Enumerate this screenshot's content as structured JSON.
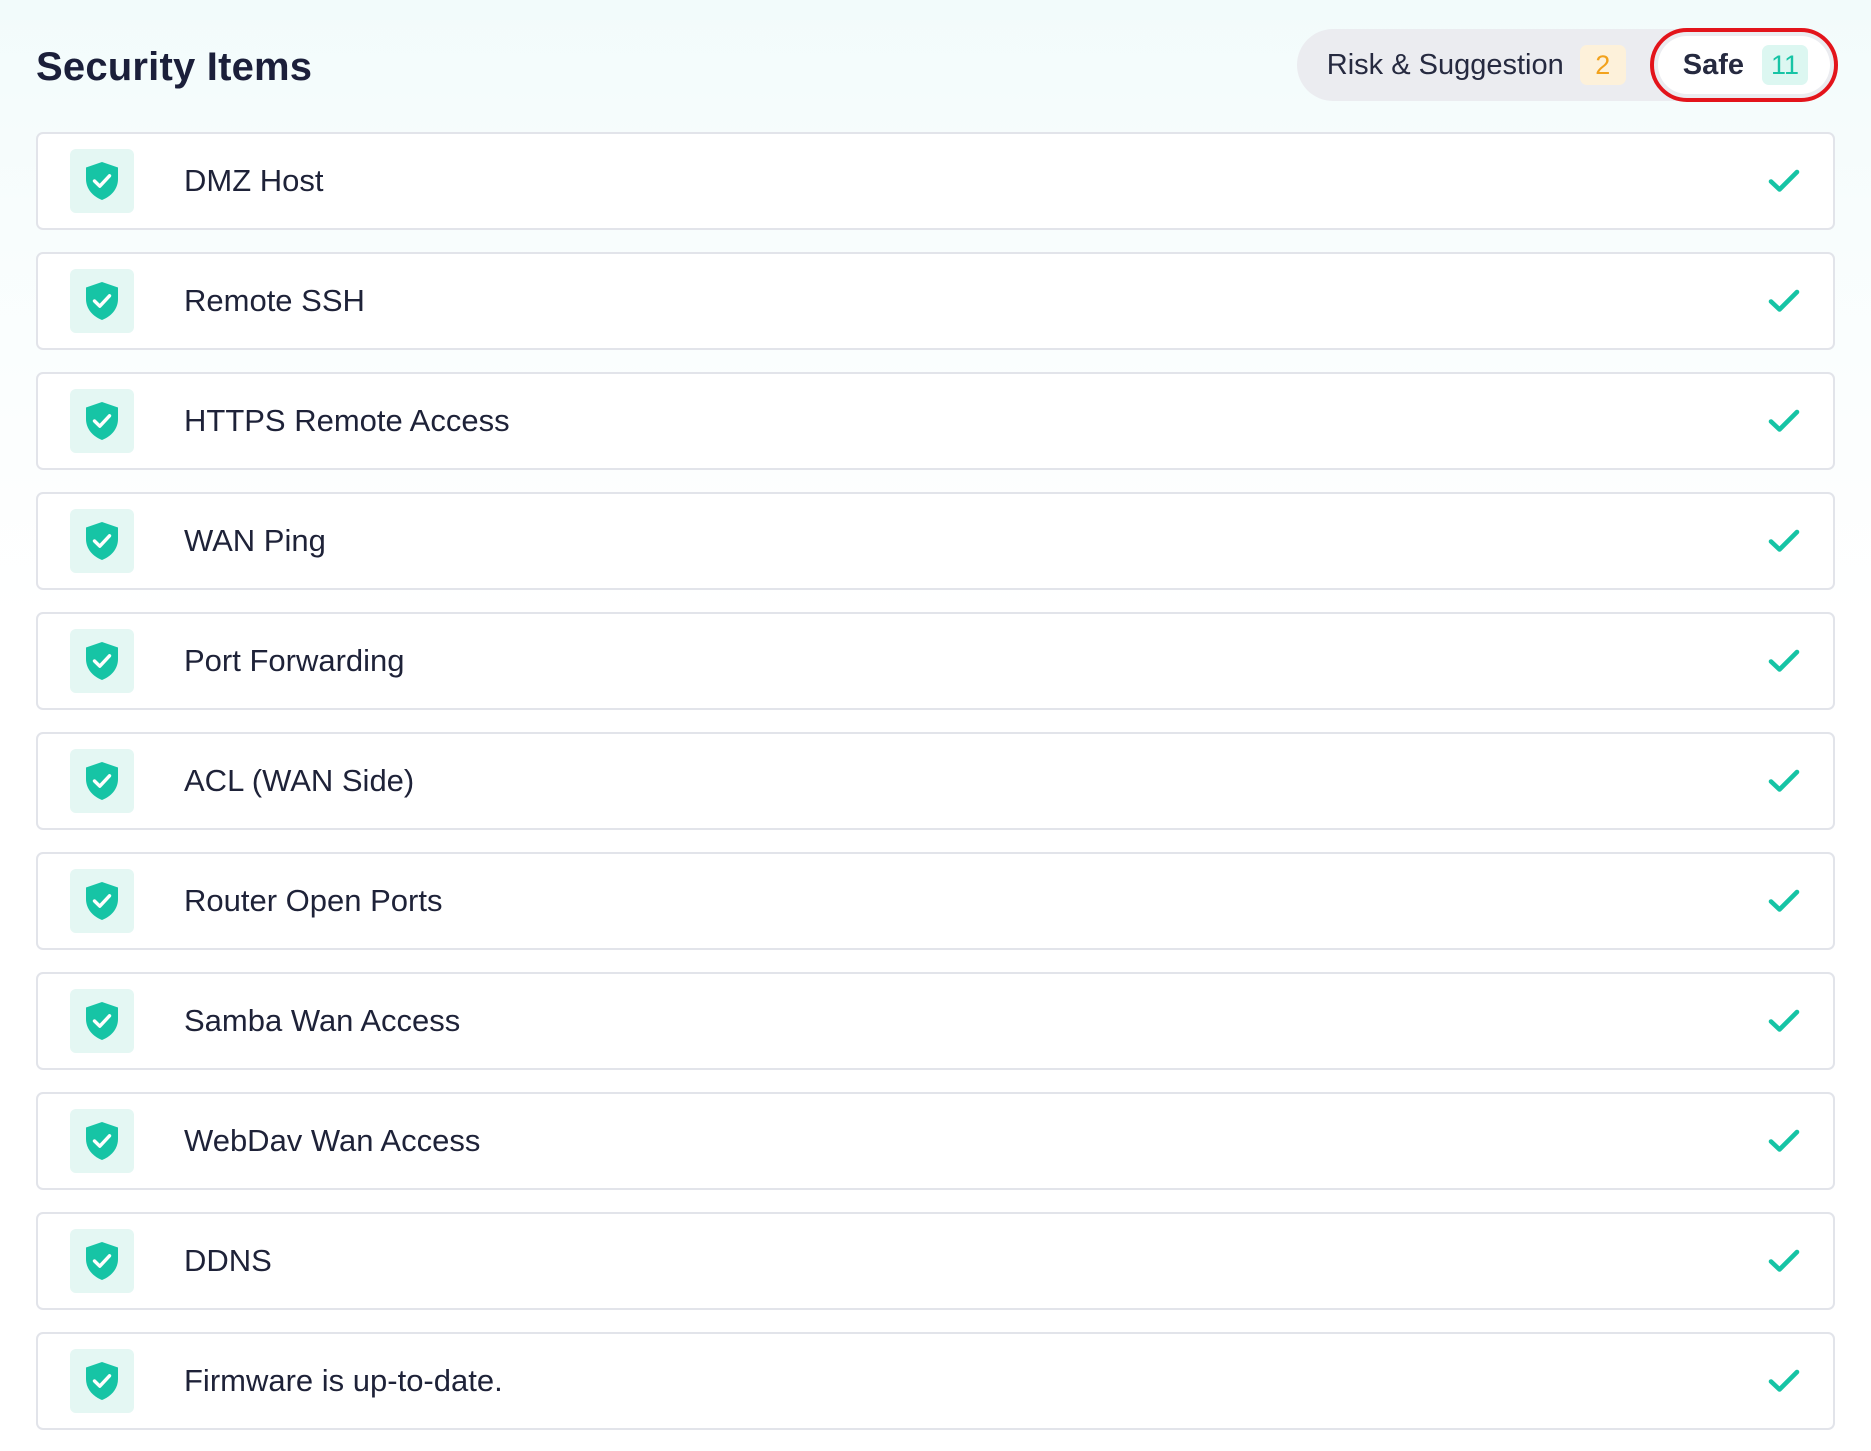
{
  "header": {
    "title": "Security Items"
  },
  "tabs": [
    {
      "label": "Risk & Suggestion",
      "count": "2",
      "selected": false
    },
    {
      "label": "Safe",
      "count": "11",
      "selected": true
    }
  ],
  "items": [
    {
      "label": "DMZ Host"
    },
    {
      "label": "Remote SSH"
    },
    {
      "label": "HTTPS Remote Access"
    },
    {
      "label": "WAN Ping"
    },
    {
      "label": "Port Forwarding"
    },
    {
      "label": "ACL (WAN Side)"
    },
    {
      "label": "Router Open Ports"
    },
    {
      "label": "Samba Wan Access"
    },
    {
      "label": "WebDav Wan Access"
    },
    {
      "label": "DDNS"
    },
    {
      "label": "Firmware is up-to-date."
    }
  ],
  "icons": {
    "item_icon": "shield-check-icon",
    "status_icon": "check-icon"
  },
  "colors": {
    "accent": "#16c4a5",
    "risk_badge": "#f2a21c",
    "selection_highlight": "#e3141b"
  }
}
